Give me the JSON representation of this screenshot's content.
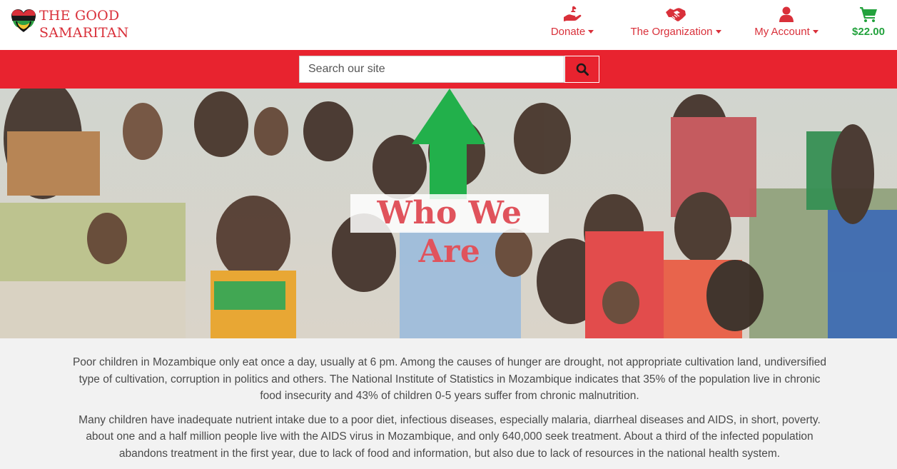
{
  "brand": {
    "line1": "THE GOOD",
    "line2": "SAMARITAN"
  },
  "nav": {
    "donate": {
      "label": "Donate",
      "icon": "hand-donate-icon"
    },
    "organization": {
      "label": "The Organization",
      "icon": "handshake-icon"
    },
    "account": {
      "label": "My Account",
      "icon": "user-icon"
    },
    "cart": {
      "amount": "$22.00",
      "icon": "shopping-cart-icon"
    }
  },
  "search": {
    "placeholder": "Search our site",
    "icon": "search-icon"
  },
  "hero": {
    "title": "Who We Are"
  },
  "content": {
    "paragraph1": "Poor children in Mozambique only eat once a day, usually at 6 pm. Among the causes of hunger are drought, not appropriate cultivation land, undiversified type of cultivation, corruption in politics and others. The National Institute of Statistics in Mozambique indicates that 35% of the population live in chronic food insecurity and 43% of children 0-5 years suffer from chronic malnutrition.",
    "paragraph2": "Many children have inadequate nutrient intake due to a poor diet, infectious diseases, especially malaria, diarrheal diseases and AIDS, in short, poverty. about one and a half million people live with the AIDS virus in Mozambique, and only 640,000 seek treatment. About a third of the infected population abandons treatment in the first year, due to lack of food and information, but also due to lack of resources in the national health system."
  },
  "colors": {
    "brand_red": "#d9303a",
    "band_red": "#e8232f",
    "cart_green": "#23a23d",
    "arrow_green": "#22b04b"
  }
}
